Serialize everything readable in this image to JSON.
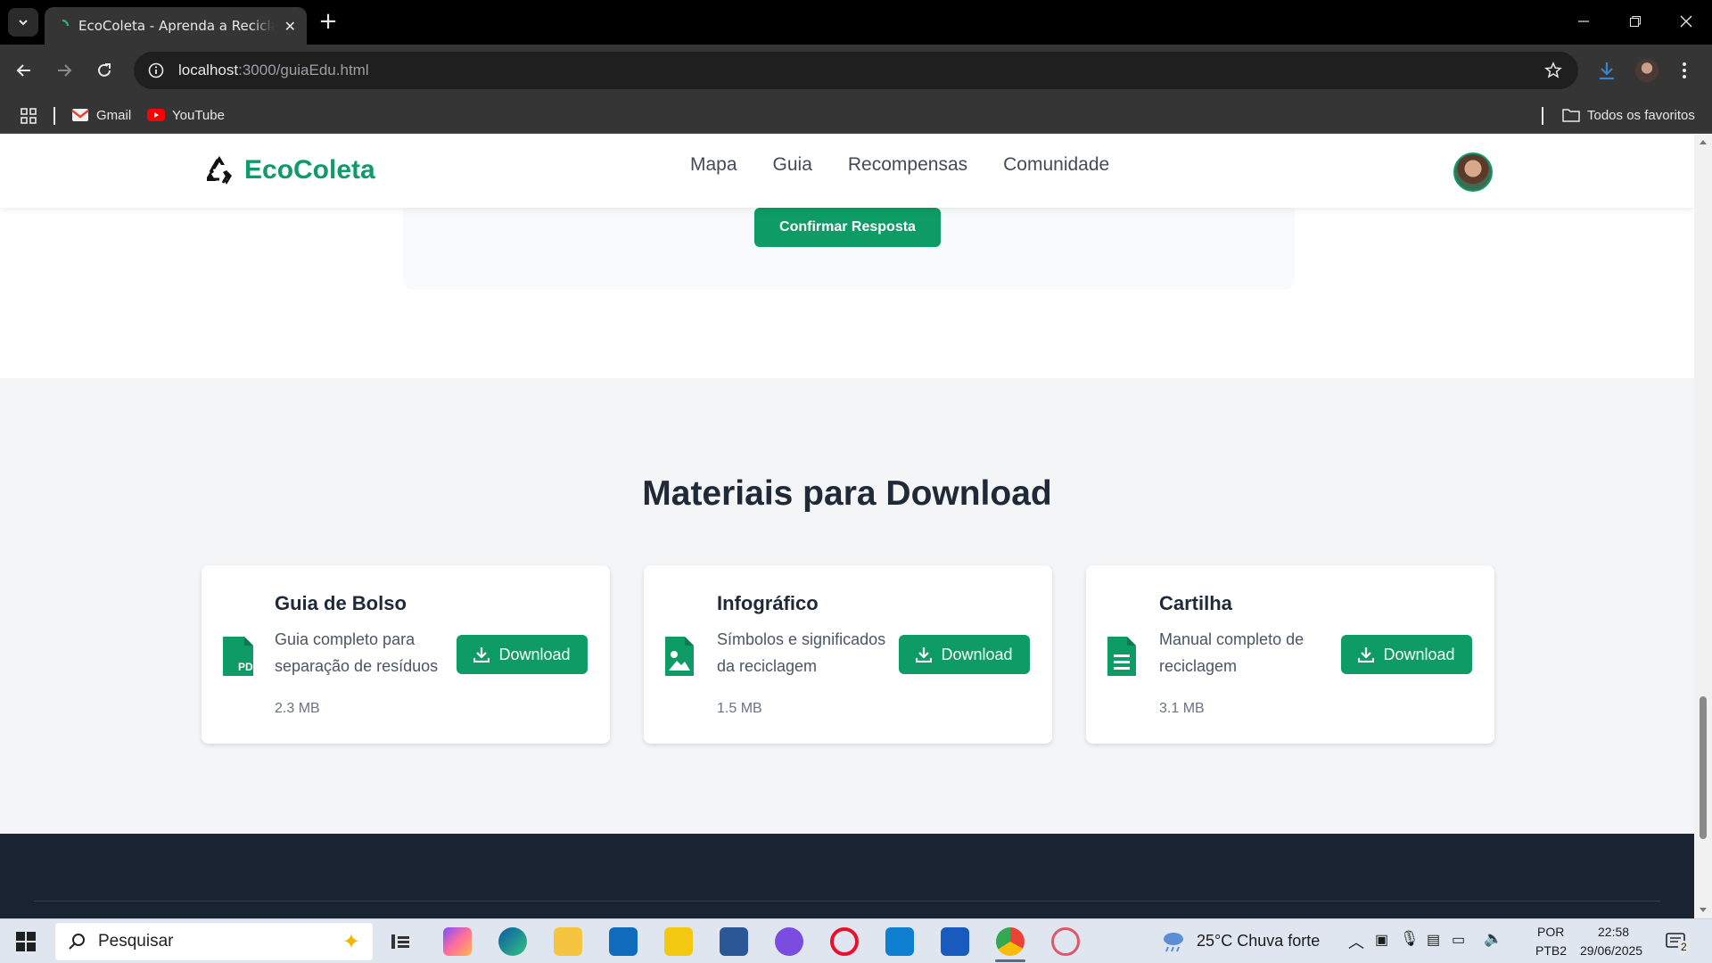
{
  "browser": {
    "tab_title": "EcoColeta - Aprenda a Reciclar",
    "url_host": "localhost",
    "url_rest": ":3000/guiaEdu.html",
    "bookmarks": [
      "Gmail",
      "YouTube"
    ],
    "all_bookmarks": "Todos os favoritos"
  },
  "site": {
    "logo_text": "EcoColeta",
    "nav": [
      "Mapa",
      "Guia",
      "Recompensas",
      "Comunidade"
    ],
    "confirm_button": "Confirmar Resposta"
  },
  "downloads": {
    "title": "Materiais para Download",
    "button_label": "Download",
    "cards": [
      {
        "title": "Guia de Bolso",
        "description": "Guia completo para separação de resíduos",
        "size": "2.3 MB",
        "icon": "pdf-file-icon"
      },
      {
        "title": "Infográfico",
        "description": "Símbolos e significados da reciclagem",
        "size": "1.5 MB",
        "icon": "image-file-icon"
      },
      {
        "title": "Cartilha",
        "description": "Manual completo de reciclagem",
        "size": "3.1 MB",
        "icon": "text-file-icon"
      }
    ]
  },
  "taskbar": {
    "search_placeholder": "Pesquisar",
    "weather": "25°C  Chuva forte",
    "lang": "POR",
    "layout": "PTB2",
    "time": "22:58",
    "date": "29/06/2025",
    "notifications": "2"
  },
  "colors": {
    "brand": "#0f9b66",
    "footer": "#1a2331"
  }
}
